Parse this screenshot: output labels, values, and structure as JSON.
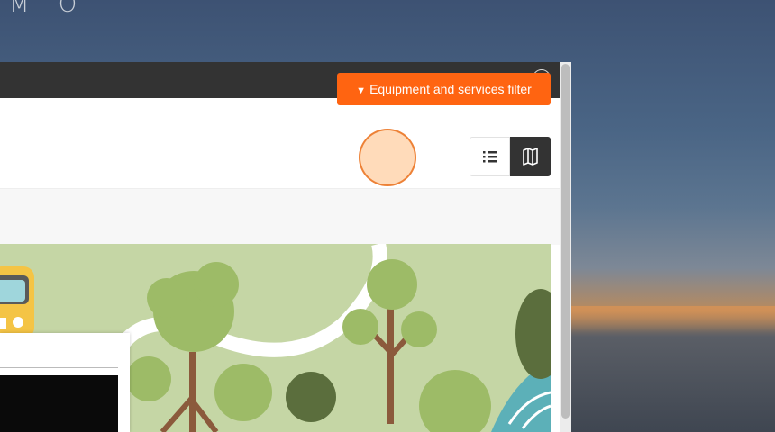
{
  "background": {
    "watermark_text": "M O"
  },
  "modal": {
    "close_icon": "close-circle-icon",
    "filter_button": {
      "label": "Equipment and services filter",
      "icon": "filter-caret-icon",
      "color": "#ff6411"
    },
    "view_toggle": [
      {
        "icon": "list-icon",
        "active": false
      },
      {
        "icon": "map-icon",
        "active": true
      }
    ]
  }
}
